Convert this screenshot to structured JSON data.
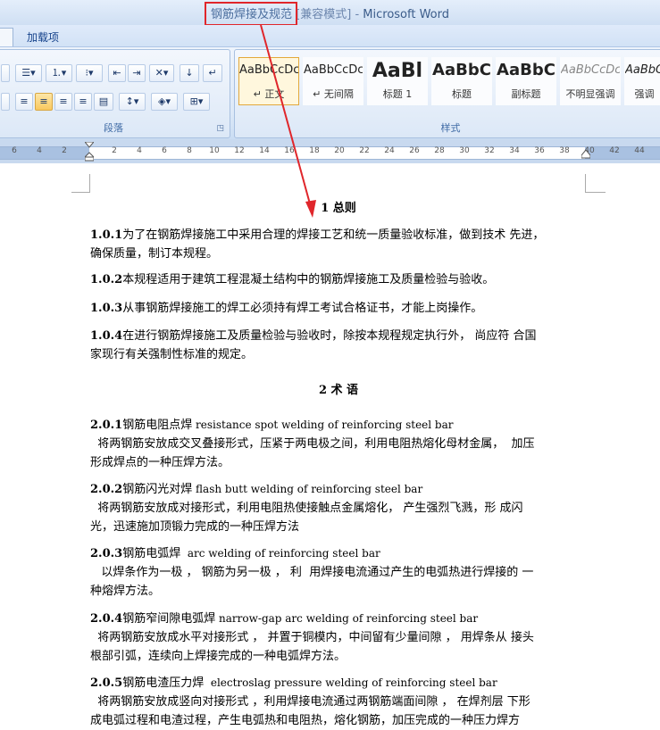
{
  "window": {
    "title_doc": "钢筋焊接及规范",
    "title_mode": "[兼容模式]",
    "title_app": "Microsoft Word"
  },
  "tabs": {
    "addins": "加载项"
  },
  "ribbon": {
    "paragraph_label": "段落",
    "styles_label": "样式",
    "styles": [
      {
        "preview": "AaBbCcDc",
        "name": "↵ 正文"
      },
      {
        "preview": "AaBbCcDc",
        "name": "↵ 无间隔"
      },
      {
        "preview": "AaBl",
        "name": "标题 1"
      },
      {
        "preview": "AaBbC",
        "name": "标题"
      },
      {
        "preview": "AaBbC",
        "name": "副标题"
      },
      {
        "preview": "AaBbCcDc",
        "name": "不明显强调"
      },
      {
        "preview": "AaBbC",
        "name": "强调"
      }
    ]
  },
  "ruler": {
    "ticks": [
      "6",
      "4",
      "2",
      "2",
      "4",
      "6",
      "8",
      "10",
      "12",
      "14",
      "16",
      "18",
      "20",
      "22",
      "24",
      "26",
      "28",
      "30",
      "32",
      "34",
      "36",
      "38",
      "40",
      "42",
      "44"
    ]
  },
  "document": {
    "h1": "1  总则",
    "p101_num": "1.0.1",
    "p101_text": "为了在钢筋焊接施工中采用合理的焊接工艺和统一质量验收标准，做到技术 先进，",
    "p101_text2": "确保质量，制订本规程。",
    "p102_num": "1.0.2",
    "p102_text": "本规程适用于建筑工程混凝土结构中的钢筋焊接施工及质量检验与验收。",
    "p103_num": "1.0.3",
    "p103_text": "从事钢筋焊接施工的焊工必须持有焊工考试合格证书，才能上岗操作。",
    "p104_num": "1.0.4",
    "p104_text": "在进行钢筋焊接施工及质量检验与验收时，除按本规程规定执行外， 尚应符 合国",
    "p104_text2": "家现行有关强制性标准的规定。",
    "h2": "2 术 语",
    "t201_num": "2.0.1",
    "t201_cn": "钢筋电阻点焊",
    "t201_en": " resistance spot welding of reinforcing steel bar",
    "t201_def": "  将两钢筋安放成交叉叠接形式，压紧于两电极之间，利用电阻热熔化母材金属，  加压",
    "t201_def2": "形成焊点的一种压焊方法。",
    "t202_num": "2.0.2",
    "t202_cn": "钢筋闪光对焊",
    "t202_en": " flash butt welding of reinforcing steel bar",
    "t202_def": "  将两钢筋安放成对接形式，利用电阻热使接触点金属熔化， 产生强烈飞溅，形 成闪",
    "t202_def2": "光，迅速施加顶锻力完成的一种压焊方法",
    "t203_num": "2.0.3",
    "t203_cn": "钢筋电弧焊",
    "t203_en": "  arc welding of reinforcing steel bar",
    "t203_def": "   以焊条作为一极 ， 钢筋为另一极 ， 利  用焊接电流通过产生的电弧热进行焊接的 一",
    "t203_def2": "种熔焊方法。",
    "t204_num": "2.0.4",
    "t204_cn": "钢筋窄间隙电弧焊",
    "t204_en": " narrow-gap arc welding of reinforcing steel bar",
    "t204_def": "  将两钢筋安放成水平对接形式 ， 并置于铜模内，中间留有少量间隙 ， 用焊条从 接头",
    "t204_def2": "根部引弧，连续向上焊接完成的一种电弧焊方法。",
    "t205_num": "2.0.5",
    "t205_cn": "钢筋电渣压力焊",
    "t205_en": "  electroslag pressure welding of reinforcing steel bar",
    "t205_def": "  将两钢筋安放成竖向对接形式 ，利用焊接电流通过两钢筋端面间隙 ， 在焊剂层 下形",
    "t205_def2": "成电弧过程和电渣过程，产生电弧热和电阻热，熔化钢筋，加压完成的一种压力焊方"
  },
  "colors": {
    "annotation": "#e0262b",
    "ribbon_text": "#15428b"
  }
}
